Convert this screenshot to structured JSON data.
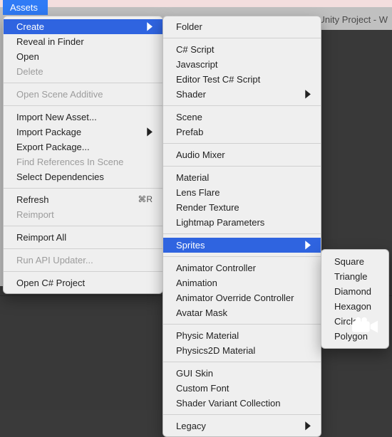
{
  "app": {
    "title_fragment": "Unity Project - W"
  },
  "menubar": {
    "active": "Assets"
  },
  "assets_menu": {
    "groups": [
      [
        {
          "label": "Create",
          "submenu": true,
          "selected": true
        },
        {
          "label": "Reveal in Finder"
        },
        {
          "label": "Open"
        },
        {
          "label": "Delete",
          "disabled": true
        }
      ],
      [
        {
          "label": "Open Scene Additive",
          "disabled": true
        }
      ],
      [
        {
          "label": "Import New Asset..."
        },
        {
          "label": "Import Package",
          "submenu": true
        },
        {
          "label": "Export Package..."
        },
        {
          "label": "Find References In Scene",
          "disabled": true
        },
        {
          "label": "Select Dependencies"
        }
      ],
      [
        {
          "label": "Refresh",
          "shortcut": "⌘R"
        },
        {
          "label": "Reimport",
          "disabled": true
        }
      ],
      [
        {
          "label": "Reimport All"
        }
      ],
      [
        {
          "label": "Run API Updater...",
          "disabled": true
        }
      ],
      [
        {
          "label": "Open C# Project"
        }
      ]
    ]
  },
  "create_menu": {
    "groups": [
      [
        {
          "label": "Folder"
        }
      ],
      [
        {
          "label": "C# Script"
        },
        {
          "label": "Javascript"
        },
        {
          "label": "Editor Test C# Script"
        },
        {
          "label": "Shader",
          "submenu": true
        }
      ],
      [
        {
          "label": "Scene"
        },
        {
          "label": "Prefab"
        }
      ],
      [
        {
          "label": "Audio Mixer"
        }
      ],
      [
        {
          "label": "Material"
        },
        {
          "label": "Lens Flare"
        },
        {
          "label": "Render Texture"
        },
        {
          "label": "Lightmap Parameters"
        }
      ],
      [
        {
          "label": "Sprites",
          "submenu": true,
          "selected": true
        }
      ],
      [
        {
          "label": "Animator Controller"
        },
        {
          "label": "Animation"
        },
        {
          "label": "Animator Override Controller"
        },
        {
          "label": "Avatar Mask"
        }
      ],
      [
        {
          "label": "Physic Material"
        },
        {
          "label": "Physics2D Material"
        }
      ],
      [
        {
          "label": "GUI Skin"
        },
        {
          "label": "Custom Font"
        },
        {
          "label": "Shader Variant Collection"
        }
      ],
      [
        {
          "label": "Legacy",
          "submenu": true
        }
      ]
    ]
  },
  "sprites_menu": {
    "items": [
      {
        "label": "Square"
      },
      {
        "label": "Triangle"
      },
      {
        "label": "Diamond"
      },
      {
        "label": "Hexagon"
      },
      {
        "label": "Circle"
      },
      {
        "label": "Polygon"
      }
    ]
  }
}
